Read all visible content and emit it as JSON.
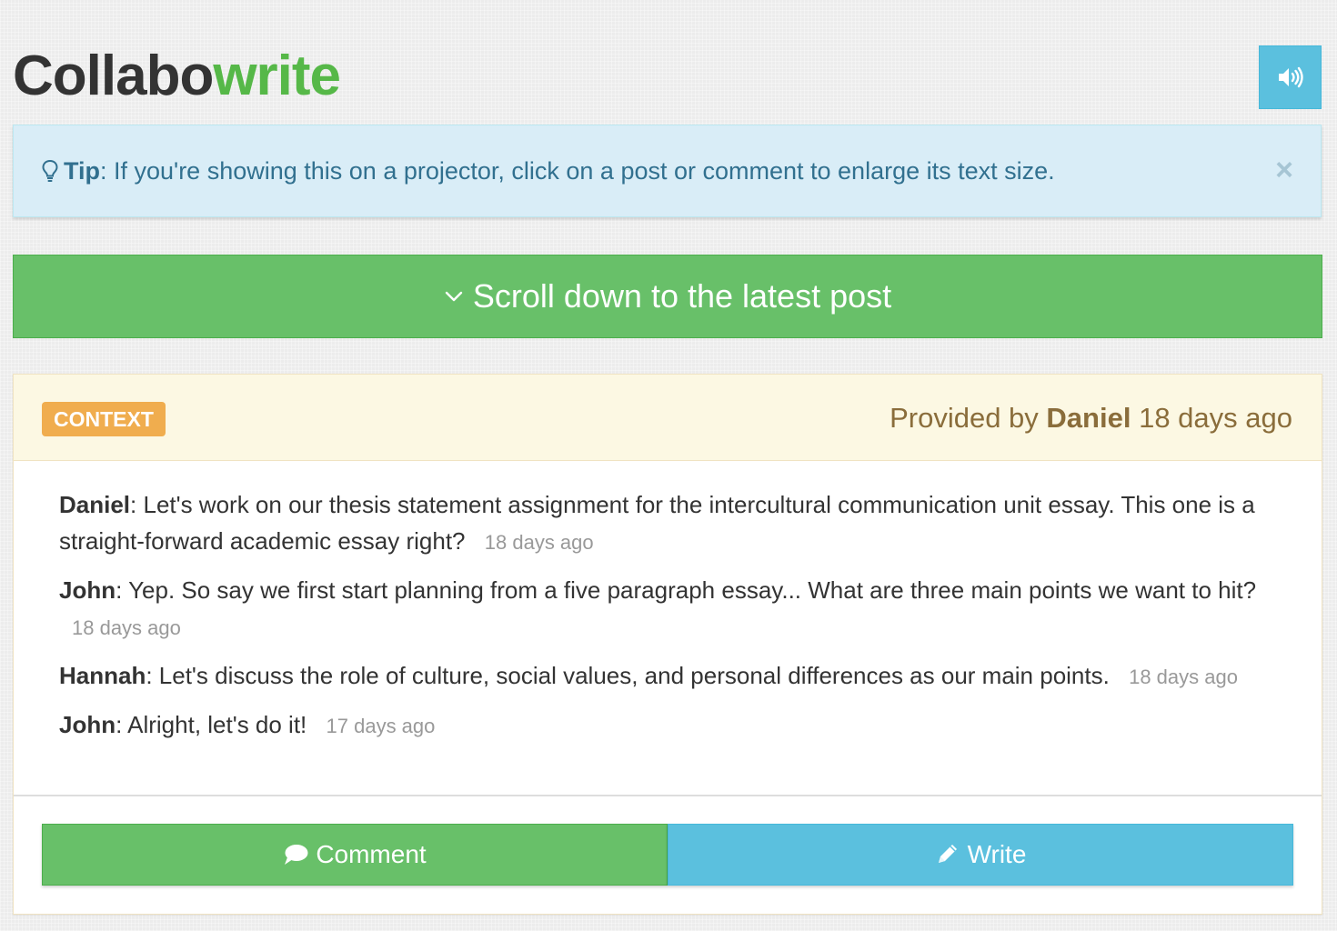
{
  "header": {
    "logo_part1": "Collabo",
    "logo_part2": "write",
    "sound_icon": "volume-up-icon"
  },
  "tip": {
    "label": "Tip",
    "text": ": If you're showing this on a projector, click on a post or comment to enlarge its text size.",
    "close": "×"
  },
  "scroll": {
    "label": "Scroll down to the latest post"
  },
  "context": {
    "badge": "CONTEXT",
    "provided_prefix": "Provided by",
    "provided_author": "Daniel",
    "provided_time": "18 days ago",
    "messages": [
      {
        "author": "Daniel",
        "text": ": Let's work on our thesis statement assignment for the intercultural communication unit essay. This one is a straight-forward academic essay right?",
        "time": "18 days ago"
      },
      {
        "author": "John",
        "text": ": Yep. So say we first start planning from a five paragraph essay... What are three main points we want to hit?",
        "time": "18 days ago"
      },
      {
        "author": "Hannah",
        "text": ": Let's discuss the role of culture, social values, and personal differences as our main points.",
        "time": "18 days ago"
      },
      {
        "author": "John",
        "text": ": Alright, let's do it!",
        "time": "17 days ago"
      }
    ],
    "comment_label": "Comment",
    "write_label": "Write"
  },
  "colors": {
    "green": "#68c069",
    "blue": "#5bc0de",
    "orange": "#f0ad4e",
    "brand_green": "#56b848"
  }
}
